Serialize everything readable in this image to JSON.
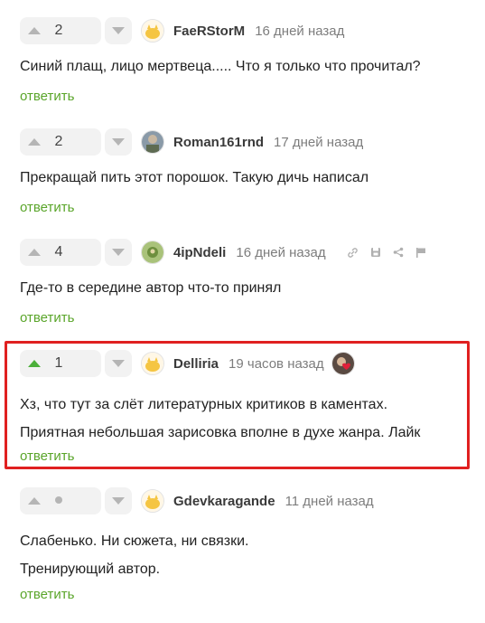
{
  "comments": [
    {
      "rating": "2",
      "username": "FaeRStorM",
      "time": "16 дней назад",
      "lines": [
        "Синий плащ, лицо мертвеца..... Что я только что прочитал?"
      ],
      "reply": "ответить",
      "avatar": "yellow-cat-avatar"
    },
    {
      "rating": "2",
      "username": "Roman161rnd",
      "time": "17 дней назад",
      "lines": [
        "Прекращай пить этот порошок. Такую дичь написал"
      ],
      "reply": "ответить",
      "avatar": "photo-avatar"
    },
    {
      "rating": "4",
      "username": "4ipNdeli",
      "time": "16 дней назад",
      "lines": [
        "Где-то в середине автор что-то принял"
      ],
      "reply": "ответить",
      "avatar": "green-photo-avatar",
      "tools": [
        "link-icon",
        "save-icon",
        "share-icon",
        "report-flag-icon"
      ]
    },
    {
      "rating": "1",
      "username": "Delliria",
      "time": "19 часов назад",
      "lines": [
        "Хз, что тут за слёт литературных критиков в каментах.",
        "Приятная небольшая зарисовка вполне в духе жанра. Лайк"
      ],
      "reply": "ответить",
      "avatar": "yellow-cat-avatar",
      "upvoted": true,
      "badge": "author-heart-avatar"
    },
    {
      "rating": "",
      "username": "Gdevkaragande",
      "time": "11 дней назад",
      "lines": [
        "Слабенько. Ни сюжета, ни связки.",
        "Тренирующий автор."
      ],
      "reply": "ответить",
      "avatar": "yellow-cat-avatar",
      "hidden_rating": true
    }
  ],
  "colors": {
    "accent_green": "#5aa52a",
    "upvote_active": "#4caf3a",
    "highlight_border": "#e02020",
    "vote_bg": "#f2f2f2"
  }
}
